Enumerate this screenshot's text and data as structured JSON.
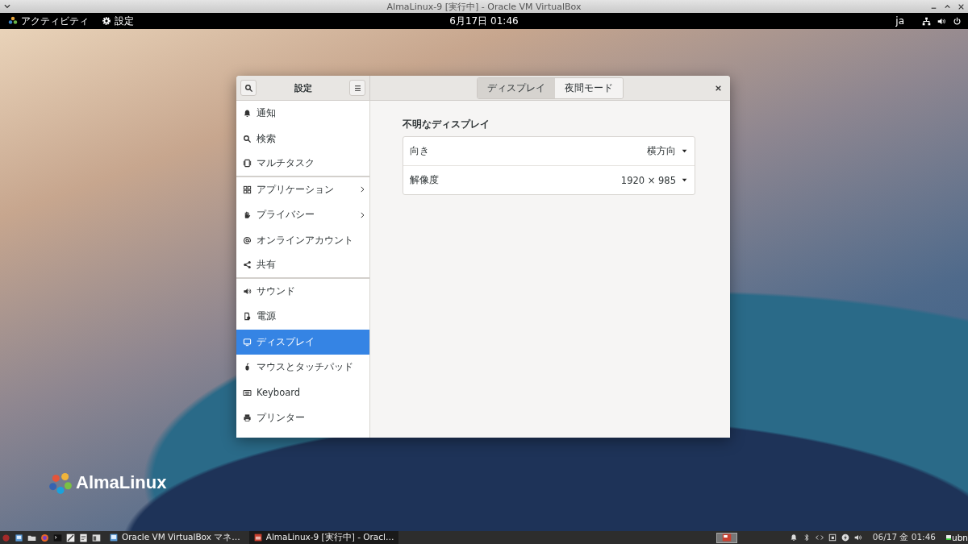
{
  "host_window": {
    "title": "AlmaLinux-9 [実行中] - Oracle VM VirtualBox"
  },
  "top_bar": {
    "activities": "アクティビティ",
    "app_menu": "設定",
    "clock": "6月17日  01:46",
    "input_method": "ja"
  },
  "settings_window": {
    "title": "設定",
    "tabs": [
      {
        "label": "ディスプレイ",
        "selected": true
      },
      {
        "label": "夜間モード",
        "selected": false
      }
    ],
    "sidebar": {
      "items": [
        {
          "kind": "bell",
          "label": "通知",
          "selected": false,
          "chevron": false,
          "group_end": false
        },
        {
          "kind": "search",
          "label": "検索",
          "selected": false,
          "chevron": false,
          "group_end": false
        },
        {
          "kind": "multitask",
          "label": "マルチタスク",
          "selected": false,
          "chevron": false,
          "group_end": true
        },
        {
          "kind": "grid",
          "label": "アプリケーション",
          "selected": false,
          "chevron": true,
          "group_end": false
        },
        {
          "kind": "hand",
          "label": "プライバシー",
          "selected": false,
          "chevron": true,
          "group_end": false
        },
        {
          "kind": "at",
          "label": "オンラインアカウント",
          "selected": false,
          "chevron": false,
          "group_end": false
        },
        {
          "kind": "share",
          "label": "共有",
          "selected": false,
          "chevron": false,
          "group_end": true
        },
        {
          "kind": "speaker",
          "label": "サウンド",
          "selected": false,
          "chevron": false,
          "group_end": false
        },
        {
          "kind": "power",
          "label": "電源",
          "selected": false,
          "chevron": false,
          "group_end": false
        },
        {
          "kind": "monitor",
          "label": "ディスプレイ",
          "selected": true,
          "chevron": false,
          "group_end": false
        },
        {
          "kind": "mouse",
          "label": "マウスとタッチパッド",
          "selected": false,
          "chevron": false,
          "group_end": false
        },
        {
          "kind": "keyboard",
          "label": "Keyboard",
          "selected": false,
          "chevron": false,
          "group_end": false
        },
        {
          "kind": "printer",
          "label": "プリンター",
          "selected": false,
          "chevron": false,
          "group_end": false
        }
      ]
    },
    "display": {
      "heading": "不明なディスプレイ",
      "rows": [
        {
          "label": "向き",
          "value": "横方向"
        },
        {
          "label": "解像度",
          "value": "1920 × 985"
        }
      ]
    }
  },
  "desktop": {
    "logo": "AlmaLinux"
  },
  "taskbar": {
    "tasks": [
      {
        "label": "Oracle VM VirtualBox マネ…",
        "selected": false
      },
      {
        "label": "AlmaLinux-9 [実行中] - Oracl…",
        "selected": true
      }
    ],
    "clock": "06/17 金 01:46",
    "panel_label": "ubn"
  }
}
